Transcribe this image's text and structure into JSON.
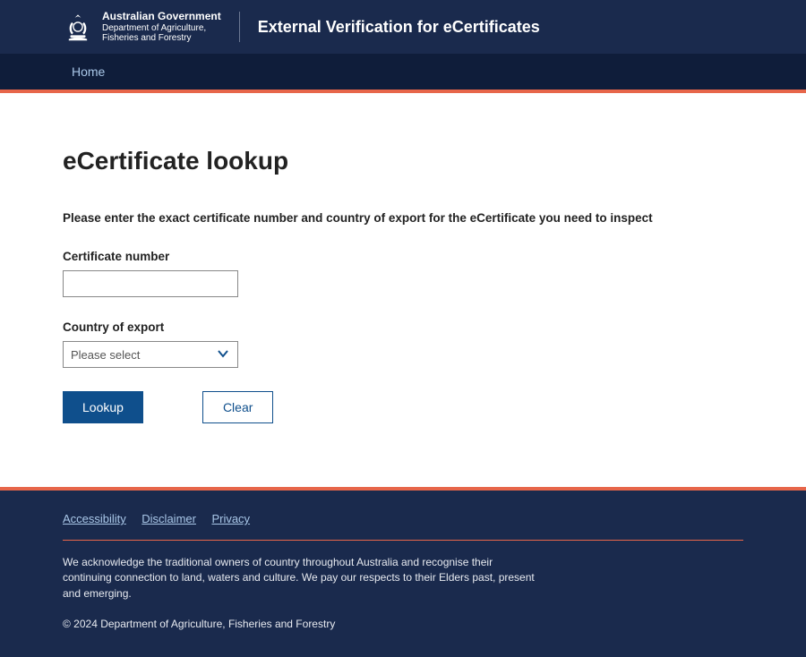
{
  "colors": {
    "accent": "#e7664a",
    "header_bg": "#1a2a4d",
    "nav_bg": "#0f1d3a",
    "primary_btn": "#0f4f8c",
    "link": "#a9c7e8"
  },
  "header": {
    "gov_line1": "Australian Government",
    "gov_line2": "Department of Agriculture,",
    "gov_line3": "Fisheries and Forestry",
    "app_title": "External Verification for eCertificates"
  },
  "nav": {
    "home": "Home"
  },
  "main": {
    "heading": "eCertificate lookup",
    "instructions": "Please enter the exact certificate number and country of export for the eCertificate you need to inspect",
    "cert_label": "Certificate number",
    "cert_value": "",
    "country_label": "Country of export",
    "country_selected": "Please select",
    "lookup_label": "Lookup",
    "clear_label": "Clear"
  },
  "footer": {
    "links": {
      "accessibility": "Accessibility",
      "disclaimer": "Disclaimer",
      "privacy": "Privacy"
    },
    "acknowledgement": "We acknowledge the traditional owners of country throughout Australia and recognise their continuing connection to land, waters and culture. We pay our respects to their Elders past, present and emerging.",
    "copyright": "© 2024 Department of Agriculture, Fisheries and Forestry"
  }
}
